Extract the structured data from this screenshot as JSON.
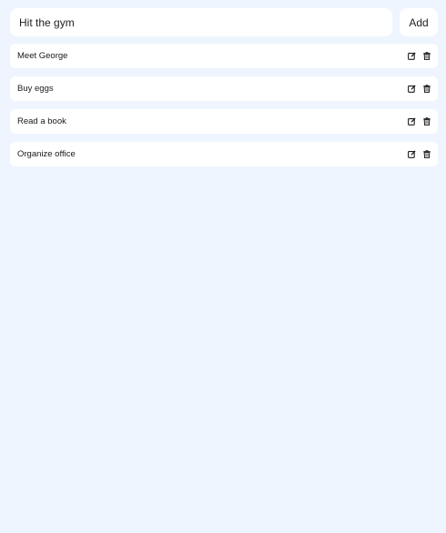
{
  "input": {
    "value": "Hit the gym",
    "placeholder": ""
  },
  "add_button": {
    "label": "Add"
  },
  "todos": [
    {
      "text": "Meet George",
      "edit_icon": "edit-icon",
      "delete_icon": "trash-icon"
    },
    {
      "text": "Buy eggs",
      "edit_icon": "edit-icon",
      "delete_icon": "trash-icon"
    },
    {
      "text": "Read a book",
      "edit_icon": "edit-icon",
      "delete_icon": "trash-icon"
    },
    {
      "text": "Organize office",
      "edit_icon": "edit-icon",
      "delete_icon": "trash-icon"
    }
  ],
  "colors": {
    "background": "#eef5ff",
    "card": "#ffffff",
    "text": "#1a1a1a"
  }
}
